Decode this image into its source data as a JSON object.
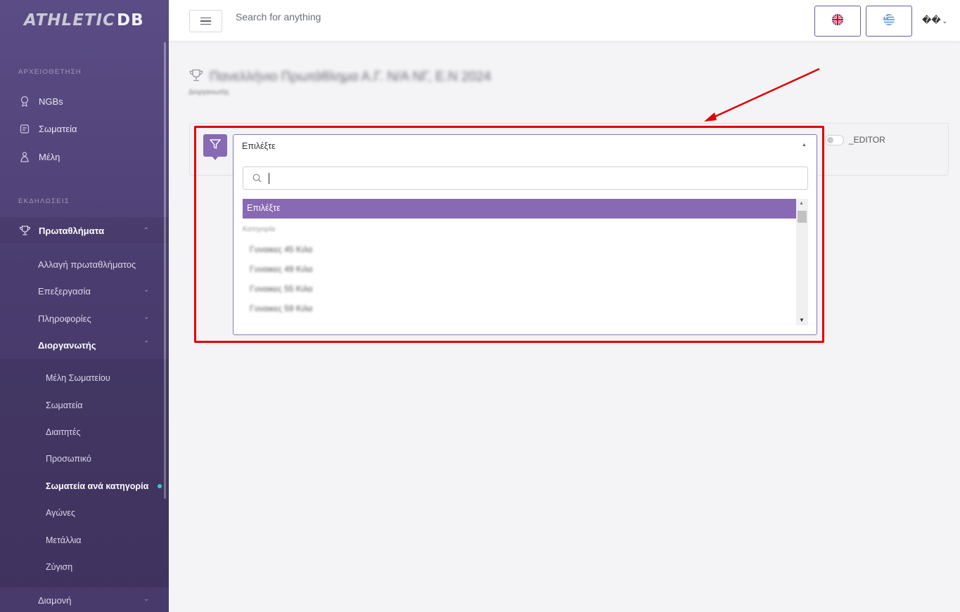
{
  "app": {
    "logo_part1": "ATHLETIC",
    "logo_part2": "DB"
  },
  "header": {
    "search_placeholder": "Search for anything",
    "languages": [
      "english-flag",
      "greek-flag"
    ],
    "user_menu": "��"
  },
  "sidebar": {
    "section1": "ΑΡΧΕΙΟΘΕΤΗΣΗ",
    "section1_items": [
      {
        "label": "NGBs",
        "icon": "medal-icon"
      },
      {
        "label": "Σωματεία",
        "icon": "building-icon"
      },
      {
        "label": "Μέλη",
        "icon": "person-icon"
      }
    ],
    "section2": "ΕΚΔΗΛΩΣΕΙΣ",
    "championships": "Πρωταθλήματα",
    "sub_items": [
      "Αλλαγή πρωταθλήματος",
      "Επεξεργασία",
      "Πληροφορίες",
      "Διοργανωτής"
    ],
    "organizer_items": [
      "Μέλη Σωματείου",
      "Σωματεία",
      "Διαιτητές",
      "Προσωπικό",
      "Σωματεία ανά κατηγορία",
      "Αγώνες",
      "Μετάλλια",
      "Ζύγιση"
    ],
    "accommodation": "Διαμονή"
  },
  "page": {
    "title": "Πανελλήνιο Πρωτάθλημα Α.Γ. Ν/Α ΝΓ, Ε.Ν 2024",
    "subtitle": "Διοργανωτής"
  },
  "filter": {
    "select_value": "Επιλέξτε",
    "selected_option": "Επιλέξτε",
    "group_label": "Κατηγορία",
    "options": [
      "Γυναικες 45 Κιλα",
      "Γυναικες 49 Κιλα",
      "Γυναικες 55 Κιλα",
      "Γυναικες 59 Κιλα"
    ],
    "toggle_label": "_EDITOR"
  },
  "colors": {
    "accent": "#8869b4",
    "annotation": "#e00000",
    "sidebar": "#4e4074"
  }
}
